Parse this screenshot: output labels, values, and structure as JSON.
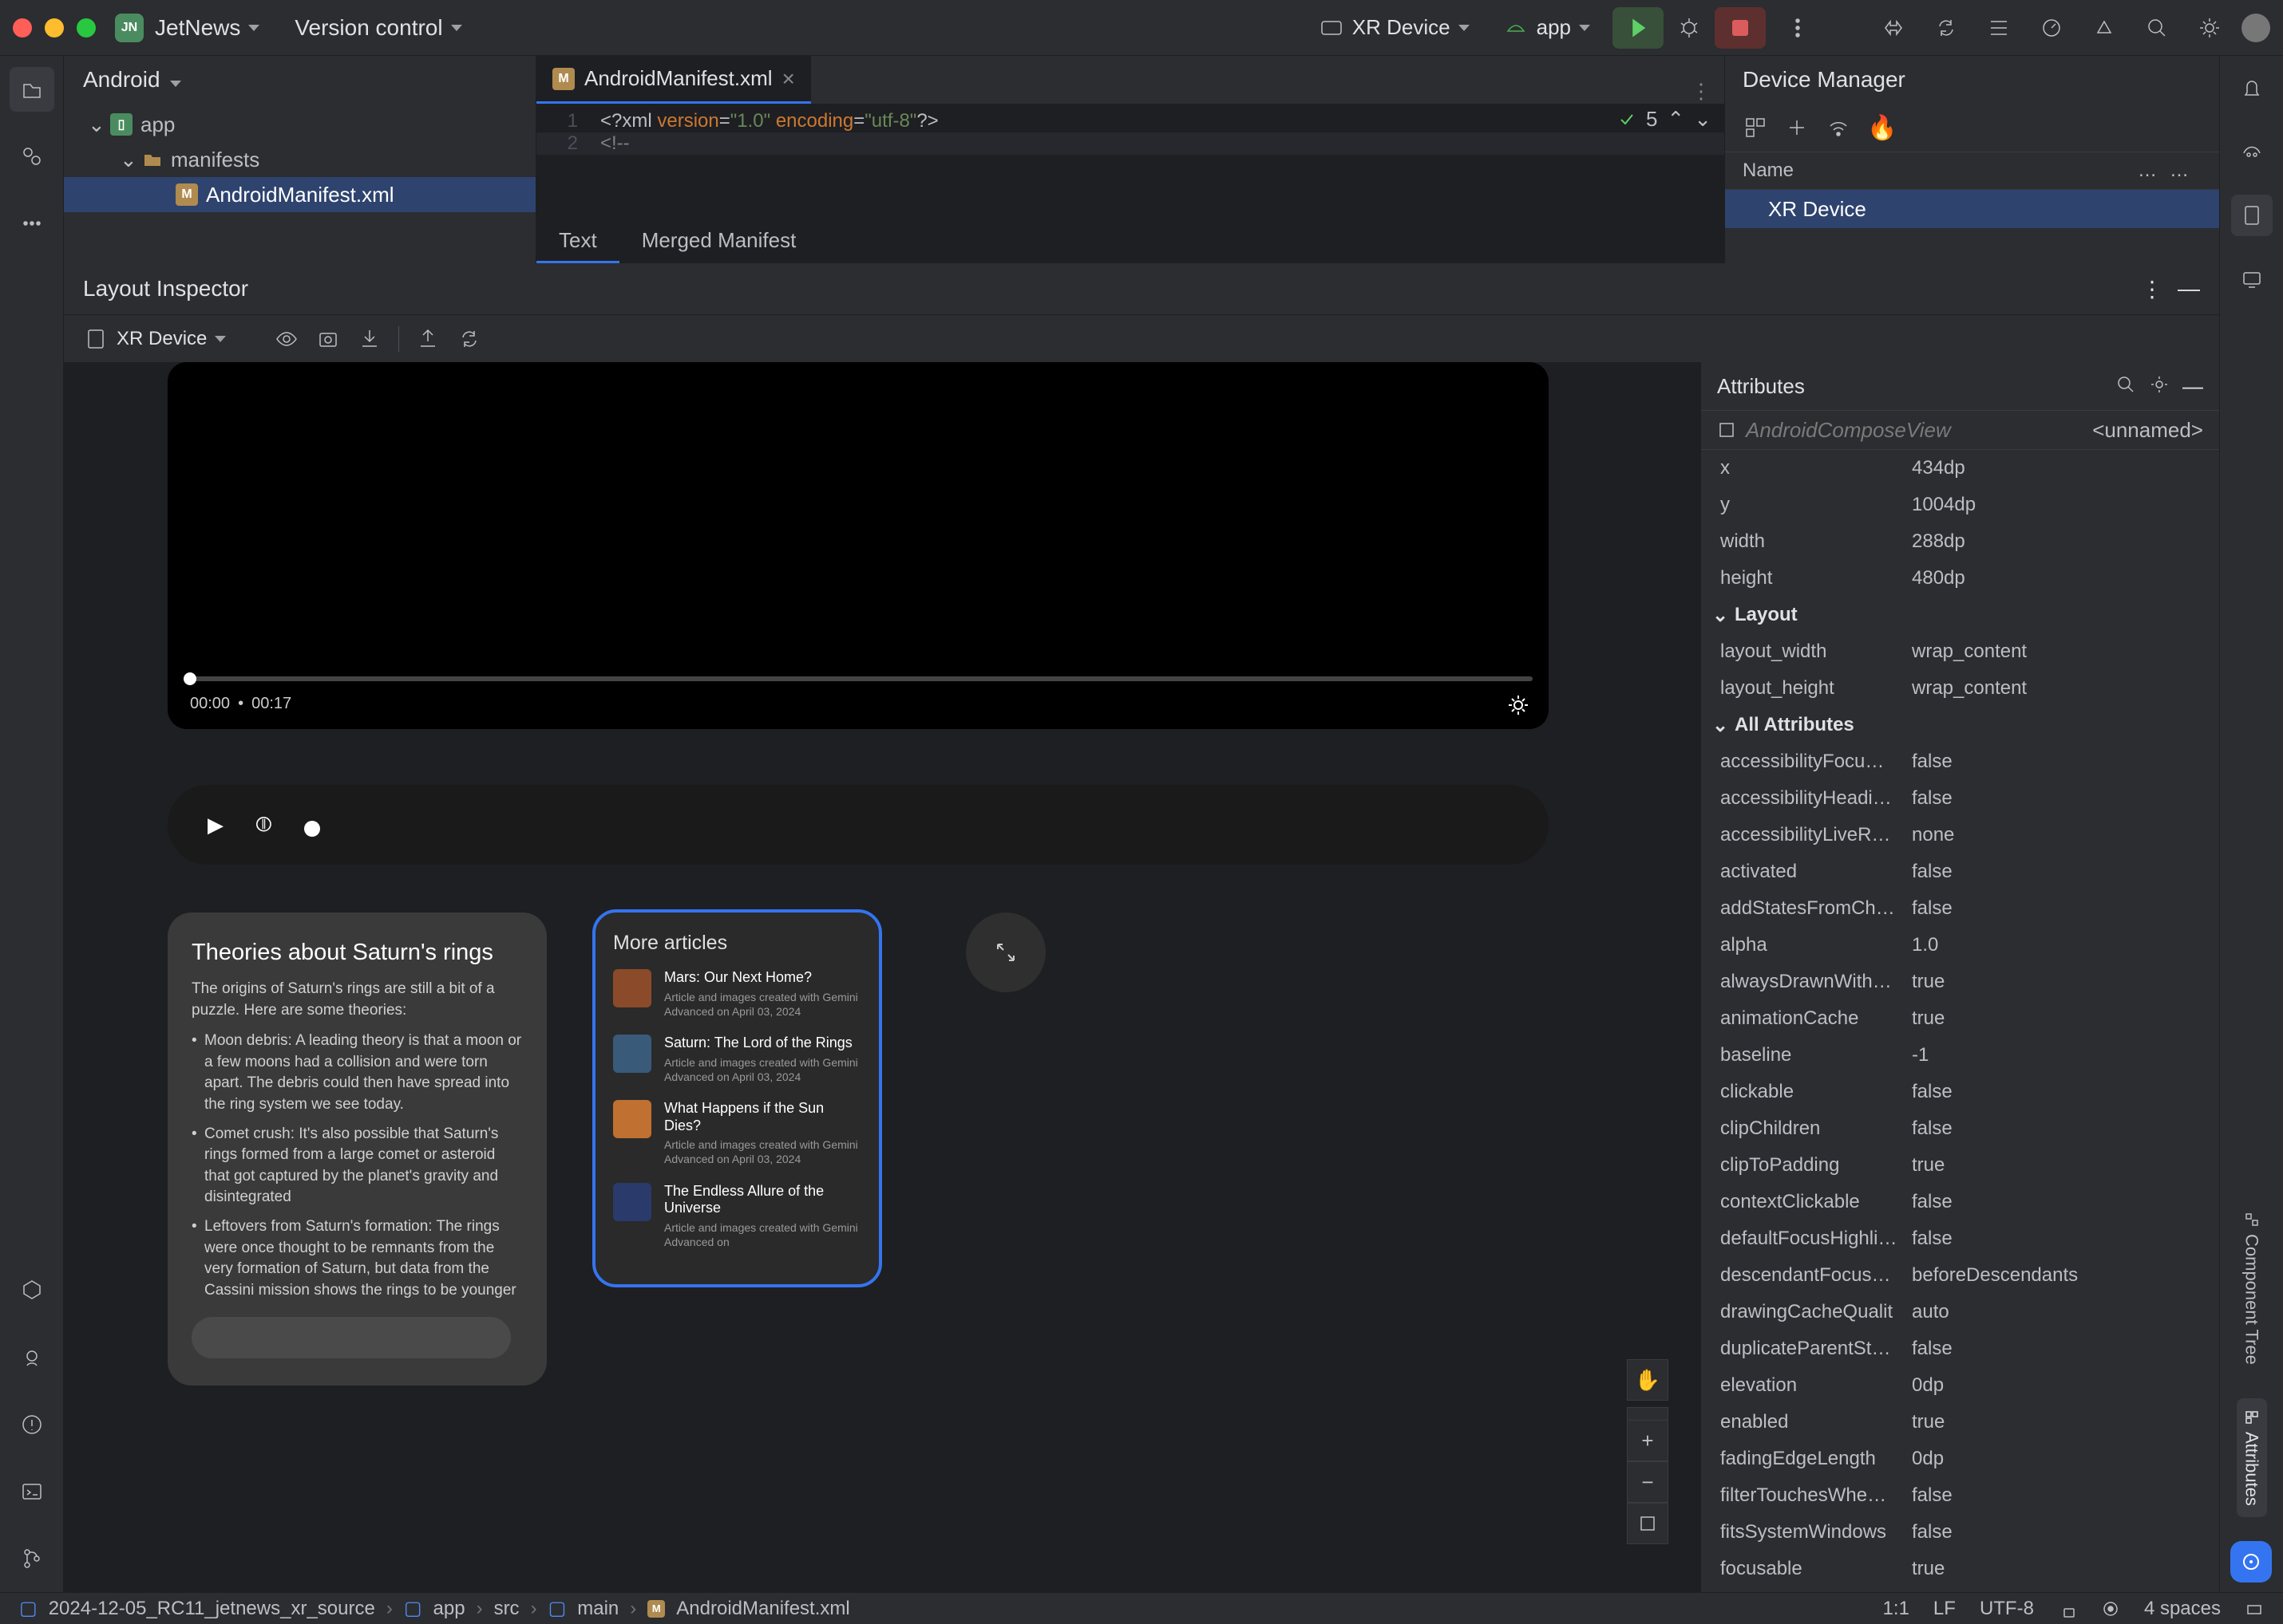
{
  "topbar": {
    "project": "JetNews",
    "projectBadge": "JN",
    "vcs": "Version control",
    "runTarget": "XR Device",
    "runConfig": "app"
  },
  "projectPanel": {
    "title": "Android",
    "tree": {
      "root": "app",
      "folder": "manifests",
      "file": "AndroidManifest.xml"
    }
  },
  "editor": {
    "fileName": "AndroidManifest.xml",
    "line1_gut": "1",
    "line1_a": "<?xml ",
    "line1_b": "version",
    "line1_c": "=",
    "line1_d": "\"1.0\"",
    "line1_e": " encoding",
    "line1_f": "=",
    "line1_g": "\"utf-8\"",
    "line1_h": "?>",
    "line2_gut": "2",
    "line2": "<!--",
    "hintCount": "5",
    "subtabs": {
      "text": "Text",
      "merged": "Merged Manifest"
    }
  },
  "deviceManager": {
    "title": "Device Manager",
    "colName": "Name",
    "row": "XR Device"
  },
  "layoutInspector": {
    "title": "Layout Inspector",
    "device": "XR Device"
  },
  "canvas": {
    "video": {
      "time": "00:00",
      "dur": "00:17"
    },
    "article": {
      "title": "Theories about Saturn's rings",
      "intro": "The origins of Saturn's rings are still a bit of a puzzle. Here are some theories:",
      "b1": "Moon debris: A leading theory is that a moon or a few moons had a collision and were torn apart. The debris could then have spread into the ring system we see today.",
      "b2": "Comet crush: It's also possible that Saturn's rings formed from a large comet or asteroid that got captured by the planet's gravity and disintegrated",
      "b3": "Leftovers from Saturn's formation: The rings were once thought to be remnants from the very formation of Saturn, but data from the Cassini mission shows the rings to be younger"
    },
    "more": {
      "title": "More articles",
      "items": [
        {
          "t": "Mars: Our Next Home?",
          "s": "Article and images created with Gemini Advanced on April 03, 2024"
        },
        {
          "t": "Saturn: The Lord of the Rings",
          "s": "Article and images created with Gemini Advanced on April 03, 2024"
        },
        {
          "t": "What Happens if the Sun Dies?",
          "s": "Article and images created with Gemini Advanced on April 03, 2024"
        },
        {
          "t": "The Endless Allure of the Universe",
          "s": "Article and images created with Gemini Advanced on"
        }
      ]
    }
  },
  "attributes": {
    "title": "Attributes",
    "typeName": "AndroidComposeView",
    "unnamed": "<unnamed>",
    "group_layout": "Layout",
    "group_all": "All Attributes",
    "rows": [
      {
        "k": "x",
        "v": "434dp"
      },
      {
        "k": "y",
        "v": "1004dp"
      },
      {
        "k": "width",
        "v": "288dp"
      },
      {
        "k": "height",
        "v": "480dp"
      }
    ],
    "layoutRows": [
      {
        "k": "layout_width",
        "v": "wrap_content"
      },
      {
        "k": "layout_height",
        "v": "wrap_content"
      }
    ],
    "allRows": [
      {
        "k": "accessibilityFocu…",
        "v": "false"
      },
      {
        "k": "accessibilityHeadi…",
        "v": "false"
      },
      {
        "k": "accessibilityLiveR…",
        "v": "none"
      },
      {
        "k": "activated",
        "v": "false"
      },
      {
        "k": "addStatesFromCh…",
        "v": "false"
      },
      {
        "k": "alpha",
        "v": "1.0"
      },
      {
        "k": "alwaysDrawnWith…",
        "v": "true"
      },
      {
        "k": "animationCache",
        "v": "true"
      },
      {
        "k": "baseline",
        "v": "-1"
      },
      {
        "k": "clickable",
        "v": "false"
      },
      {
        "k": "clipChildren",
        "v": "false"
      },
      {
        "k": "clipToPadding",
        "v": "true"
      },
      {
        "k": "contextClickable",
        "v": "false"
      },
      {
        "k": "defaultFocusHighli…",
        "v": "false"
      },
      {
        "k": "descendantFocus…",
        "v": "beforeDescendants"
      },
      {
        "k": "drawingCacheQualit",
        "v": "auto"
      },
      {
        "k": "duplicateParentSt…",
        "v": "false"
      },
      {
        "k": "elevation",
        "v": "0dp"
      },
      {
        "k": "enabled",
        "v": "true"
      },
      {
        "k": "fadingEdgeLength",
        "v": "0dp"
      },
      {
        "k": "filterTouchesWhe…",
        "v": "false"
      },
      {
        "k": "fitsSystemWindows",
        "v": "false"
      },
      {
        "k": "focusable",
        "v": "true"
      }
    ]
  },
  "sideTabs": {
    "comp": "Component Tree",
    "attr": "Attributes"
  },
  "statusbar": {
    "crumbs": [
      "2024-12-05_RC11_jetnews_xr_source",
      "app",
      "src",
      "main",
      "AndroidManifest.xml"
    ],
    "pos": "1:1",
    "le": "LF",
    "enc": "UTF-8",
    "indent": "4 spaces"
  }
}
